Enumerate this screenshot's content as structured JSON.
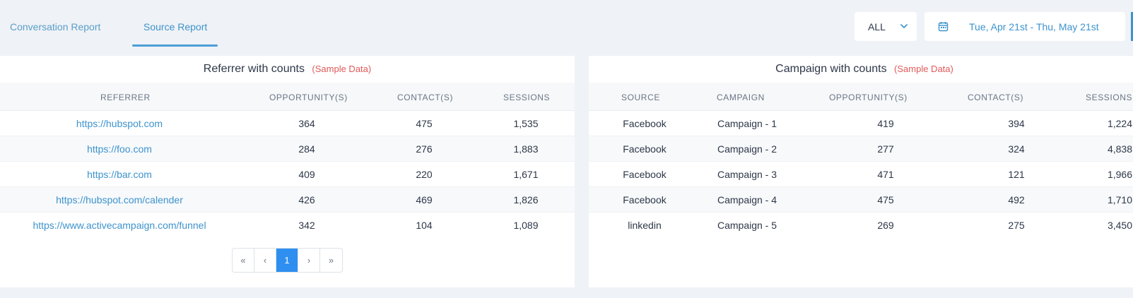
{
  "tabs": [
    {
      "label": "Conversation Report"
    },
    {
      "label": "Source Report"
    }
  ],
  "active_tab": "Source Report",
  "filter": {
    "selected": "ALL",
    "icon": "chevron-down-icon"
  },
  "date_range": {
    "text": "Tue, Apr 21st - Thu, May 21st",
    "icon": "calendar-icon"
  },
  "referrer_table": {
    "title": "Referrer with counts",
    "sample_note": "(Sample Data)",
    "columns": [
      "REFERRER",
      "OPPORTUNITY(S)",
      "CONTACT(S)",
      "SESSIONS"
    ],
    "rows": [
      [
        "https://hubspot.com",
        "364",
        "475",
        "1,535"
      ],
      [
        "https://foo.com",
        "284",
        "276",
        "1,883"
      ],
      [
        "https://bar.com",
        "409",
        "220",
        "1,671"
      ],
      [
        "https://hubspot.com/calender",
        "426",
        "469",
        "1,826"
      ],
      [
        "https://www.activecampaign.com/funnel",
        "342",
        "104",
        "1,089"
      ]
    ]
  },
  "campaign_table": {
    "title": "Campaign with counts",
    "sample_note": "(Sample Data)",
    "columns": [
      "SOURCE",
      "CAMPAIGN",
      "OPPORTUNITY(S)",
      "CONTACT(S)",
      "SESSIONS"
    ],
    "rows": [
      [
        "Facebook",
        "Campaign - 1",
        "419",
        "394",
        "1,224"
      ],
      [
        "Facebook",
        "Campaign - 2",
        "277",
        "324",
        "4,838"
      ],
      [
        "Facebook",
        "Campaign - 3",
        "471",
        "121",
        "1,966"
      ],
      [
        "Facebook",
        "Campaign - 4",
        "475",
        "492",
        "1,710"
      ],
      [
        "linkedin",
        "Campaign - 5",
        "269",
        "275",
        "3,450"
      ]
    ]
  },
  "pagination": {
    "first": "«",
    "prev": "‹",
    "current": "1",
    "next": "›",
    "last": "»"
  },
  "colors": {
    "accent": "#2f8ff0",
    "link": "#3d93cc",
    "sample_note": "#e05a5a",
    "background": "#eff2f6"
  }
}
